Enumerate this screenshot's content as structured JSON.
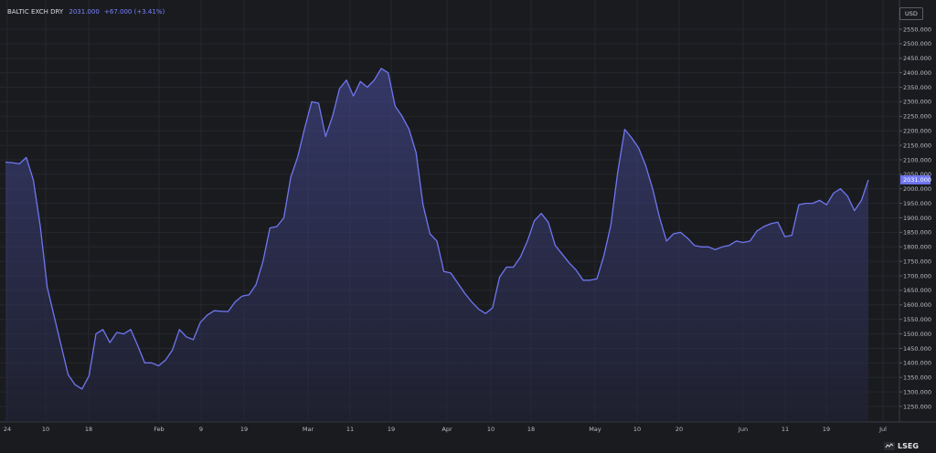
{
  "header": {
    "symbol": "BALTIC EXCH DRY",
    "last": "2031.000",
    "change": "+67.000 (+3.41%)"
  },
  "currency": "USD",
  "brand": "LSEG",
  "colors": {
    "background": "#1a1b1f",
    "grid": "#26272c",
    "line": "#6f76f0",
    "price_tag": "#6f76f0",
    "text": "#b9bcc4"
  },
  "chart_data": {
    "type": "area",
    "series_color": "#6f76f0",
    "last_label": "2031.000",
    "ylim": [
      1200,
      2600
    ],
    "y_ticks": [
      "1250.000",
      "1300.000",
      "1350.000",
      "1400.000",
      "1450.000",
      "1500.000",
      "1550.000",
      "1600.000",
      "1650.000",
      "1700.000",
      "1750.000",
      "1800.000",
      "1850.000",
      "1900.000",
      "1950.000",
      "2000.000",
      "2050.000",
      "2100.000",
      "2150.000",
      "2200.000",
      "2250.000",
      "2300.000",
      "2350.000",
      "2400.000",
      "2450.000",
      "2500.000",
      "2550.000"
    ],
    "x_ticks": [
      "24",
      "10",
      "18",
      "Feb",
      "9",
      "19",
      "Mar",
      "11",
      "19",
      "Apr",
      "10",
      "18",
      "May",
      "10",
      "20",
      "Jun",
      "11",
      "19",
      "Jul"
    ],
    "values": [
      2092,
      2090,
      2086,
      2108,
      2030,
      1870,
      1660,
      1560,
      1460,
      1360,
      1325,
      1310,
      1355,
      1500,
      1515,
      1470,
      1505,
      1500,
      1515,
      1460,
      1400,
      1400,
      1390,
      1410,
      1445,
      1515,
      1490,
      1480,
      1540,
      1565,
      1580,
      1578,
      1577,
      1610,
      1630,
      1635,
      1670,
      1750,
      1865,
      1870,
      1900,
      2040,
      2110,
      2210,
      2300,
      2295,
      2180,
      2250,
      2345,
      2375,
      2320,
      2370,
      2350,
      2375,
      2415,
      2400,
      2285,
      2250,
      2205,
      2125,
      1945,
      1845,
      1820,
      1715,
      1710,
      1675,
      1640,
      1610,
      1585,
      1570,
      1590,
      1695,
      1730,
      1730,
      1765,
      1820,
      1890,
      1915,
      1885,
      1805,
      1775,
      1745,
      1720,
      1685,
      1685,
      1690,
      1770,
      1875,
      2060,
      2205,
      2175,
      2140,
      2080,
      2000,
      1900,
      1820,
      1845,
      1850,
      1830,
      1805,
      1800,
      1800,
      1790,
      1800,
      1805,
      1820,
      1815,
      1820,
      1855,
      1870,
      1880,
      1885,
      1835,
      1840,
      1945,
      1950,
      1950,
      1960,
      1945,
      1985,
      2000,
      1975,
      1925,
      1960,
      2031
    ]
  }
}
